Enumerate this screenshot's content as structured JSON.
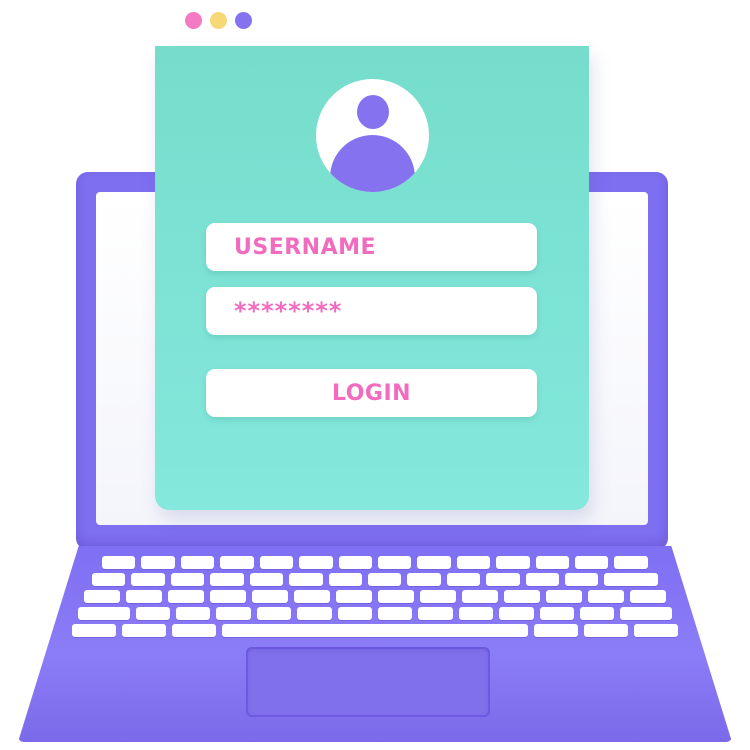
{
  "window": {
    "dots": [
      {
        "name": "pink",
        "color": "#f47ac4"
      },
      {
        "name": "yellow",
        "color": "#f7d877"
      },
      {
        "name": "purple",
        "color": "#8472ef"
      }
    ]
  },
  "login_card": {
    "username_placeholder": "USERNAME",
    "password_value": "********",
    "login_label": "LOGIN"
  },
  "colors": {
    "card": "#7ee4d6",
    "laptop": "#7e6ef0",
    "accent_text": "#f16bbf"
  }
}
